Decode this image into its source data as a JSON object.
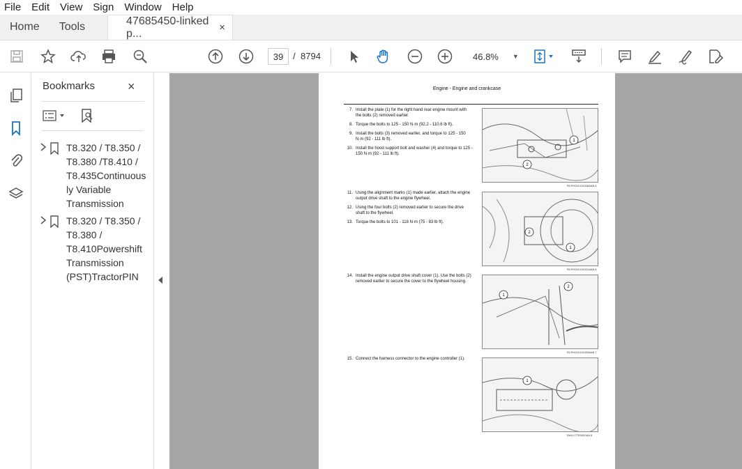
{
  "menu": [
    "File",
    "Edit",
    "View",
    "Sign",
    "Window",
    "Help"
  ],
  "tabs": {
    "home": "Home",
    "tools": "Tools",
    "document": "47685450-linked p...",
    "close": "×"
  },
  "toolbar": {
    "page_current": "39",
    "page_sep": "/",
    "page_total": "8794",
    "zoom": "46.8%",
    "zoom_caret": "▼"
  },
  "bookmarks": {
    "title": "Bookmarks",
    "close": "×",
    "items": [
      {
        "label": "T8.320 / T8.350 / T8.380 /T8.410 / T8.435Continuously Variable Transmission"
      },
      {
        "label": "T8.320 / T8.350 / T8.380 / T8.410Powershift Transmission (PST)TractorPIN"
      }
    ]
  },
  "pdf": {
    "header": "Engine - Engine and crankcase",
    "steps": [
      {
        "n": "7.",
        "t": "Install the plate (1) for the right hand rear engine mount with the bolts (2) removed earlier."
      },
      {
        "n": "8.",
        "t": "Torque the bolts to 125 - 150 N·m (92.2 - 110.6 lb ft)."
      },
      {
        "n": "9.",
        "t": "Install the bolts (3) removed earlier, and torque to 125 - 150 N·m (92 - 111 lb ft)."
      },
      {
        "n": "10.",
        "t": "Install the hood support bolt and washer (4) and torque to 125 - 150 N·m (92 - 111 lb ft)."
      },
      {
        "n": "11.",
        "t": "Using the alignment marks (1) made earlier, attach the engine output drive shaft to the engine flywheel."
      },
      {
        "n": "12.",
        "t": "Using the four bolts (2) removed earlier to secure the drive shaft to the flywheel."
      },
      {
        "n": "13.",
        "t": "Torque the bolts to 101 - 118 N·m (75 - 83 lb ft)."
      },
      {
        "n": "14.",
        "t": "Install the engine output drive shaft cover (1). Use the bolts (2) removed earlier to secure the cover to the flywheel housing."
      },
      {
        "n": "15.",
        "t": "Connect the harness connector to the engine controller (1)."
      }
    ],
    "figures": [
      {
        "caption": "RCPH10CCH028AAB   5",
        "callouts": [
          "1",
          "2"
        ]
      },
      {
        "caption": "RCPH10CCH031AAB   6",
        "callouts": [
          "2",
          "1"
        ]
      },
      {
        "caption": "RCPH10CCH033AAB   7",
        "callouts": [
          "1",
          "2"
        ]
      },
      {
        "caption": "RAIL17TR0420AA   8",
        "callouts": [
          "1"
        ]
      }
    ]
  }
}
